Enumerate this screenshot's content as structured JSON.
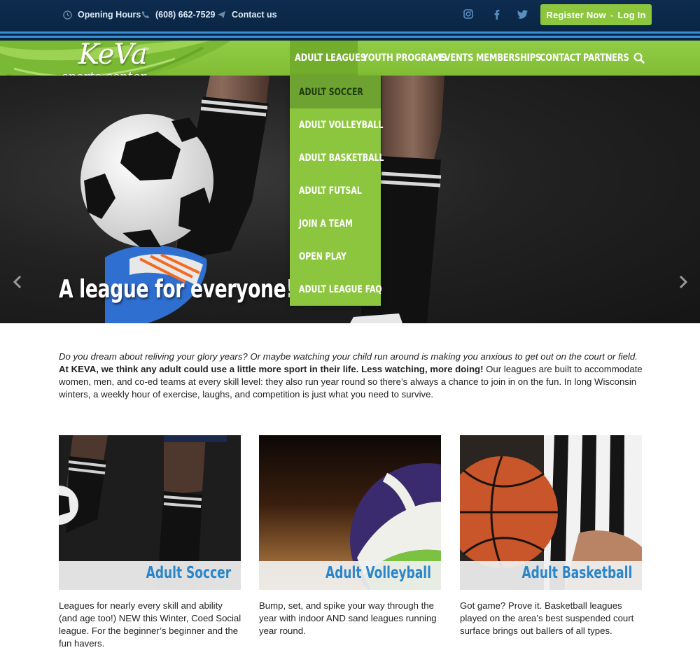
{
  "topbar": {
    "hours": "Opening Hours",
    "phone": "(608) 662-7529",
    "contact": "Contact us",
    "social": [
      "instagram-icon",
      "facebook-icon",
      "twitter-icon"
    ],
    "register": "Register Now",
    "login": "Log In",
    "separator": "-"
  },
  "logo": {
    "main": "KeVa",
    "tm": "™",
    "sub": "sports center"
  },
  "nav": {
    "items": [
      "ADULT LEAGUES",
      "YOUTH PROGRAMS",
      "EVENTS",
      "MEMBERSHIPS",
      "CONTACT",
      "PARTNERS"
    ],
    "search_icon": "search-icon"
  },
  "dropdown": {
    "items": [
      "ADULT SOCCER",
      "ADULT VOLLEYBALL",
      "ADULT BASKETBALL",
      "ADULT FUTSAL",
      "JOIN A TEAM",
      "OPEN PLAY",
      "ADULT LEAGUE FAQ"
    ]
  },
  "hero": {
    "caption": "A league for everyone!"
  },
  "intro": {
    "italic": "Do you dream about reliving your glory years? Or maybe watching your child run around is making you anxious to get out on the court or field.",
    "bold": "At KEVA, we think any adult could use a little more sport in their life. Less watching, more doing!",
    "rest": " Our leagues are built to accommodate women, men, and co-ed teams at every skill level: they also run year round so there’s always a chance to join in on the fun. In long Wisconsin winters, a weekly hour of exercise, laughs, and competition is just what you need to survive."
  },
  "cards": [
    {
      "title": "Adult Soccer",
      "desc": "Leagues for nearly every skill and ability (and age too!) NEW this Winter, Coed Social league. For the beginner’s beginner and the fun havers."
    },
    {
      "title": "Adult Volleyball",
      "desc": "Bump, set, and spike your way through the year with indoor AND sand leagues running year round."
    },
    {
      "title": "Adult Basketball",
      "desc": "Got game? Prove it. Basketball leagues played on the area’s best suspended court surface brings out ballers of all types."
    }
  ],
  "colors": {
    "navy": "#0a2646",
    "green": "#8cc63f",
    "blue_accent": "#2a86c9"
  }
}
